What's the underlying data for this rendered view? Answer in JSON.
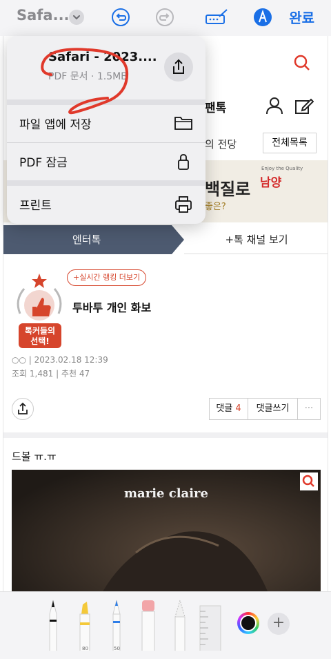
{
  "topbar": {
    "app_title": "Safa...",
    "done_label": "완료",
    "icons": [
      "chevron-down-icon",
      "undo-icon",
      "redo-icon",
      "markup-pen-icon",
      "markup-circle-icon"
    ]
  },
  "page": {
    "nav_tok": "팬톡",
    "hall_text": "의 전당",
    "all_list_btn": "전체목록",
    "banner_text": "백질로",
    "banner_sub": "좋은?",
    "banner_brand_small": "Enjoy the Quality",
    "banner_brand": "남양",
    "tab_active": "엔터톡",
    "tab_other": "+톡 채널 보기",
    "rank_link": "+실시간 랭킹 더보기",
    "badge_text_1": "톡커들의",
    "badge_text_2": "선택!",
    "post_title": "투바투 개인 화보",
    "post_author": "○○",
    "post_date": "| 2023.02.18 12:39",
    "post_views": "조회 1,481",
    "post_recommend": "| 추천 47",
    "comment_label": "댓글",
    "comment_count": "4",
    "write_comment": "댓글쓰기",
    "more": "···",
    "body_text": "드볼 ㅠ.ㅠ",
    "photo_brand": "marie claire"
  },
  "popover": {
    "file_name": "Safari - 2023....",
    "file_meta": "PDF 문서 · 1.5MB",
    "rows": [
      {
        "label": "파일 앱에 저장",
        "icon": "folder-icon"
      },
      {
        "label": "PDF 잠금",
        "icon": "lock-icon"
      },
      {
        "label": "프린트",
        "icon": "printer-icon"
      }
    ]
  },
  "palette": {
    "tools": [
      "pen",
      "marker",
      "pencil",
      "eraser",
      "lasso",
      "ruler"
    ],
    "marker_width": "80",
    "pencil_width": "50",
    "selected_color": "#111111",
    "add_label": "+"
  },
  "colors": {
    "accent": "#1a6fe6",
    "annotation": "#e0392b",
    "tab_active_bg": "#4d5a70"
  }
}
